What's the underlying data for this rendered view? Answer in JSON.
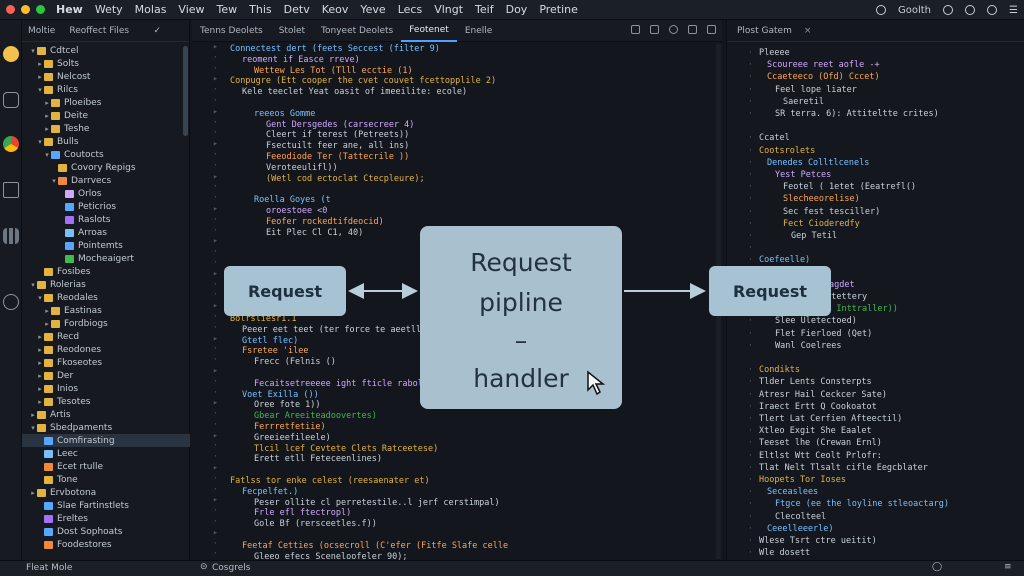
{
  "menubar": {
    "items": [
      "Hew",
      "Wety",
      "Molas",
      "View",
      "Tew",
      "This",
      "Detv",
      "Keov",
      "Yeve",
      "Lecs",
      "Vlngt",
      "Teif",
      "Doy",
      "Pretine"
    ],
    "right_label": "Goolth",
    "traffic_colors": [
      "#ff5f57",
      "#febc2e",
      "#28c840"
    ]
  },
  "sidebar": {
    "tabs": [
      "Moltie",
      "Reoffect Files"
    ],
    "tree": [
      {
        "label": "Cdtcel",
        "indent": 1,
        "color": "#e3b341",
        "twisty": "v"
      },
      {
        "label": "Solts",
        "indent": 2,
        "color": "#e3b341",
        "twisty": ">"
      },
      {
        "label": "Nelcost",
        "indent": 2,
        "color": "#e3b341",
        "twisty": ">"
      },
      {
        "label": "Rilcs",
        "indent": 2,
        "color": "#e3b341",
        "twisty": "v"
      },
      {
        "label": "Ploeibes",
        "indent": 3,
        "color": "#e3b341",
        "twisty": ">"
      },
      {
        "label": "Deite",
        "indent": 3,
        "color": "#e3b341",
        "twisty": ">"
      },
      {
        "label": "Teshe",
        "indent": 3,
        "color": "#e3b341",
        "twisty": ">"
      },
      {
        "label": "Bulls",
        "indent": 2,
        "color": "#e3b341",
        "twisty": "v"
      },
      {
        "label": "Coutocts",
        "indent": 3,
        "color": "#58a6ff",
        "twisty": "v"
      },
      {
        "label": "Covory Repigs",
        "indent": 4,
        "color": "#e3b341",
        "twisty": ""
      },
      {
        "label": "Darrvecs",
        "indent": 4,
        "color": "#f0883e",
        "twisty": "v"
      },
      {
        "label": "Orlos",
        "indent": 5,
        "color": "#d2a8ff",
        "twisty": ""
      },
      {
        "label": "Peticrios",
        "indent": 5,
        "color": "#58a6ff",
        "twisty": ""
      },
      {
        "label": "Raslots",
        "indent": 5,
        "color": "#a371f7",
        "twisty": ""
      },
      {
        "label": "Arroas",
        "indent": 5,
        "color": "#79c0ff",
        "twisty": ""
      },
      {
        "label": "Pointemts",
        "indent": 5,
        "color": "#58a6ff",
        "twisty": ""
      },
      {
        "label": "Mocheaigert",
        "indent": 5,
        "color": "#3fb950",
        "twisty": ""
      },
      {
        "label": "Fosibes",
        "indent": 2,
        "color": "#e3b341",
        "twisty": ""
      },
      {
        "label": "Rolerias",
        "indent": 1,
        "color": "#e3b341",
        "twisty": "v"
      },
      {
        "label": "Reodales",
        "indent": 2,
        "color": "#e3b341",
        "twisty": "v"
      },
      {
        "label": "Eastinas",
        "indent": 3,
        "color": "#e3b341",
        "twisty": ">"
      },
      {
        "label": "Fordbiogs",
        "indent": 3,
        "color": "#e3b341",
        "twisty": ">"
      },
      {
        "label": "Recd",
        "indent": 2,
        "color": "#e3b341",
        "twisty": ">"
      },
      {
        "label": "Reodones",
        "indent": 2,
        "color": "#e3b341",
        "twisty": ">"
      },
      {
        "label": "Fkoseotes",
        "indent": 2,
        "color": "#e3b341",
        "twisty": ">"
      },
      {
        "label": "Der",
        "indent": 2,
        "color": "#e3b341",
        "twisty": ">"
      },
      {
        "label": "Inios",
        "indent": 2,
        "color": "#e3b341",
        "twisty": ">"
      },
      {
        "label": "Tesotes",
        "indent": 2,
        "color": "#e3b341",
        "twisty": ">"
      },
      {
        "label": "Artis",
        "indent": 1,
        "color": "#e3b341",
        "twisty": ">"
      },
      {
        "label": "Sbedpaments",
        "indent": 1,
        "color": "#e3b341",
        "twisty": "v"
      },
      {
        "label": "Comfirasting",
        "indent": 2,
        "color": "#58a6ff",
        "twisty": "",
        "selected": true
      },
      {
        "label": "Leec",
        "indent": 2,
        "color": "#79c0ff",
        "twisty": ""
      },
      {
        "label": "Ecet rtulle",
        "indent": 2,
        "color": "#f0883e",
        "twisty": ""
      },
      {
        "label": "Tone",
        "indent": 2,
        "color": "#e3b341",
        "twisty": ""
      },
      {
        "label": "Ervbotona",
        "indent": 1,
        "color": "#e3b341",
        "twisty": ">"
      },
      {
        "label": "Slae Fartinstlets",
        "indent": 2,
        "color": "#58a6ff",
        "twisty": ""
      },
      {
        "label": "Ereltes",
        "indent": 2,
        "color": "#a371f7",
        "twisty": ""
      },
      {
        "label": "Dost Sophoats",
        "indent": 2,
        "color": "#58a6ff",
        "twisty": ""
      },
      {
        "label": "Foodestores",
        "indent": 2,
        "color": "#f0883e",
        "twisty": ""
      }
    ]
  },
  "statusbar": {
    "left": "Fleat Mole",
    "center": "Cosgrels"
  },
  "editor": {
    "tabs": [
      {
        "label": "Tenns Deolets",
        "active": false
      },
      {
        "label": "Stolet",
        "active": false
      },
      {
        "label": "Tonyeet Deolets",
        "active": false
      },
      {
        "label": "Feotenet",
        "active": true
      },
      {
        "label": "Enelle",
        "active": false
      }
    ],
    "lines": [
      {
        "indent": 0,
        "text": "Connectest dert (feets Seccest (filter 9)",
        "color": "#79c0ff"
      },
      {
        "indent": 1,
        "text": "reoment if Easce rreve)",
        "color": "#d2a8ff"
      },
      {
        "indent": 2,
        "text": "Wettew Les Tot (Tlll ecctie (1)",
        "color": "#ffa657"
      },
      {
        "indent": 0,
        "text": "Conpugre (Ett cooper the cvet couvet fcettopplile 2)",
        "color": "#e3b341"
      },
      {
        "indent": 1,
        "text": "Kele teeclet Yeat oasit of imeeilite: ecole)",
        "color": "#c9d1d9"
      },
      {
        "indent": 0,
        "text": "",
        "color": "#c9d1d9"
      },
      {
        "indent": 2,
        "text": "reeeos Gomme",
        "color": "#79c0ff"
      },
      {
        "indent": 3,
        "text": "Gent Dersgedes (carsecreer 4)",
        "color": "#d2a8ff"
      },
      {
        "indent": 3,
        "text": "Cleert if terest (Petreets))",
        "color": "#c9d1d9"
      },
      {
        "indent": 3,
        "text": "Fsectuilt feer ane, all ins)",
        "color": "#c9d1d9"
      },
      {
        "indent": 3,
        "text": "Feeodiode Ter (Tattecrile ))",
        "color": "#ffa657"
      },
      {
        "indent": 3,
        "text": "Veroteeulifl))",
        "color": "#c9d1d9"
      },
      {
        "indent": 3,
        "text": "(Wetl cod ectoclat Ctecpleure);",
        "color": "#e3b341"
      },
      {
        "indent": 0,
        "text": "",
        "color": "#c9d1d9"
      },
      {
        "indent": 2,
        "text": "Roella Goyes (t",
        "color": "#79c0ff"
      },
      {
        "indent": 3,
        "text": "oroestoee <0",
        "color": "#d2a8ff"
      },
      {
        "indent": 3,
        "text": "Feofer rockedtifdeocid)",
        "color": "#ffa657"
      },
      {
        "indent": 3,
        "text": "Eit Plec Cl C1, 40)",
        "color": "#c9d1d9"
      },
      {
        "indent": 0,
        "text": "",
        "color": "#c9d1d9"
      },
      {
        "indent": 0,
        "text": "",
        "color": "#c9d1d9"
      },
      {
        "indent": 0,
        "text": "",
        "color": "#c9d1d9"
      },
      {
        "indent": 0,
        "text": "",
        "color": "#c9d1d9"
      },
      {
        "indent": 0,
        "text": "",
        "color": "#c9d1d9"
      },
      {
        "indent": 0,
        "text": "",
        "color": "#c9d1d9"
      },
      {
        "indent": 0,
        "text": "",
        "color": "#c9d1d9"
      },
      {
        "indent": 0,
        "text": "Bolrsliesr1.1",
        "color": "#e3b341"
      },
      {
        "indent": 1,
        "text": "Peeer eet teet (ter force te aeetllles",
        "color": "#c9d1d9"
      },
      {
        "indent": 1,
        "text": "Gtetl flec)",
        "color": "#79c0ff"
      },
      {
        "indent": 1,
        "text": "Fsretee 'ilee",
        "color": "#ffa657"
      },
      {
        "indent": 2,
        "text": "Frecc (Felnis ()",
        "color": "#c9d1d9"
      },
      {
        "indent": 0,
        "text": "",
        "color": "#c9d1d9"
      },
      {
        "indent": 2,
        "text": "Fecaitsetreeeee ight fticle rabolec",
        "color": "#d2a8ff"
      },
      {
        "indent": 1,
        "text": "Voet Exilla ())",
        "color": "#79c0ff"
      },
      {
        "indent": 2,
        "text": "Oree fote  1))",
        "color": "#c9d1d9"
      },
      {
        "indent": 2,
        "text": "Gbear Areeiteadoovertes)",
        "color": "#3fb950"
      },
      {
        "indent": 2,
        "text": "Ferrretfetiie)",
        "color": "#ffa657"
      },
      {
        "indent": 2,
        "text": "Greeieefileele)",
        "color": "#c9d1d9"
      },
      {
        "indent": 2,
        "text": "Tlcil lcef Cevtete Clets Ratceetese)",
        "color": "#e3b341"
      },
      {
        "indent": 2,
        "text": "Erett etll Feteceenlines)",
        "color": "#c9d1d9"
      },
      {
        "indent": 0,
        "text": "",
        "color": "#c9d1d9"
      },
      {
        "indent": 0,
        "text": "Fatlss tor enke celest (reesaenater et)",
        "color": "#e3b341"
      },
      {
        "indent": 1,
        "text": "Fecpelfet.)",
        "color": "#79c0ff"
      },
      {
        "indent": 2,
        "text": "Peser ollite cl perretestile..l jerf cerstimpal)",
        "color": "#c9d1d9"
      },
      {
        "indent": 2,
        "text": "Frle efl ftectropl)",
        "color": "#d2a8ff"
      },
      {
        "indent": 2,
        "text": "Gole Bf (rersceetles.f))",
        "color": "#c9d1d9"
      },
      {
        "indent": 0,
        "text": "",
        "color": "#c9d1d9"
      },
      {
        "indent": 1,
        "text": "Feetaf Cetties (ocsecroll (C'efer (Fitfe Slafe celle",
        "color": "#ffa657"
      },
      {
        "indent": 2,
        "text": "Gleeo efecs Sceneloofeler 90);",
        "color": "#c9d1d9"
      }
    ]
  },
  "rightpanel": {
    "tab": "Plost Gatem",
    "blocks": [
      {
        "start": 1,
        "lines": [
          {
            "indent": 0,
            "text": "Pleeee",
            "color": "#c9d1d9"
          },
          {
            "indent": 1,
            "text": "Scoureee reet aofle -+",
            "color": "#d2a8ff"
          },
          {
            "indent": 1,
            "text": "Ccaeteeco (Ofd) Cccet)",
            "color": "#ffa657"
          },
          {
            "indent": 2,
            "text": "Feel lope liater",
            "color": "#c9d1d9"
          },
          {
            "indent": 3,
            "text": "Saeretil",
            "color": "#c9d1d9"
          },
          {
            "indent": 2,
            "text": "SR terra.  6): Attiteltte crites)",
            "color": "#c9d1d9"
          }
        ]
      },
      {
        "start": 5,
        "lines": [
          {
            "indent": 0,
            "text": "Ccatel",
            "color": "#c9d1d9"
          },
          {
            "indent": 0,
            "text": "Cootsrolets",
            "color": "#e3b341"
          },
          {
            "indent": 1,
            "text": "Denedes Colltlcenels",
            "color": "#79c0ff"
          },
          {
            "indent": 2,
            "text": "Yest Petces",
            "color": "#d2a8ff"
          },
          {
            "indent": 3,
            "text": "Feotel ( 1etet (Eeatrefl()",
            "color": "#c9d1d9"
          },
          {
            "indent": 3,
            "text": "Slecheeorelise)",
            "color": "#ffa657"
          },
          {
            "indent": 3,
            "text": "Sec fest tesciller)",
            "color": "#c9d1d9"
          },
          {
            "indent": 3,
            "text": "Fect Cioderedfy",
            "color": "#e3b341"
          },
          {
            "indent": 4,
            "text": "Gep Tetil",
            "color": "#c9d1d9"
          },
          {
            "indent": 0,
            "text": "",
            "color": "#c9d1d9"
          },
          {
            "indent": 0,
            "text": "Coefeelle)",
            "color": "#79c0ff"
          },
          {
            "indent": 2,
            "text": "Flerees",
            "color": "#c9d1d9"
          },
          {
            "indent": 3,
            "text": "Eistlk Plagdet",
            "color": "#d2a8ff"
          },
          {
            "indent": 2,
            "text": "Sertatle Eltettery",
            "color": "#c9d1d9"
          },
          {
            "indent": 2,
            "text": "Ecl sutplie Inttraller))",
            "color": "#3fb950"
          },
          {
            "indent": 2,
            "text": "Slee Uletectoed)",
            "color": "#c9d1d9"
          },
          {
            "indent": 2,
            "text": "Flet Fierloed (Qet)",
            "color": "#c9d1d9"
          },
          {
            "indent": 2,
            "text": "Wanl Coelrees",
            "color": "#c9d1d9"
          }
        ]
      },
      {
        "start": 11,
        "lines": [
          {
            "indent": 0,
            "text": "Condikts",
            "color": "#e3b341"
          },
          {
            "indent": 0,
            "text": "Tlder Lents Consterpts",
            "color": "#c9d1d9"
          },
          {
            "indent": 0,
            "text": "Atresr Hail Ceckcer Sate)",
            "color": "#c9d1d9"
          },
          {
            "indent": 0,
            "text": "Iraect Ertt  Q  Cookoatot",
            "color": "#c9d1d9"
          },
          {
            "indent": 0,
            "text": "Tlert Lat Cerfien Afteectil)",
            "color": "#c9d1d9"
          },
          {
            "indent": 0,
            "text": "Xtleo Exgit She Eaalet",
            "color": "#c9d1d9"
          },
          {
            "indent": 0,
            "text": "Teeset lhe (Crewan Ernl)",
            "color": "#c9d1d9"
          },
          {
            "indent": 0,
            "text": "Eltlst Wtt Ceolt Prlofr:",
            "color": "#c9d1d9"
          },
          {
            "indent": 0,
            "text": "Tlat Nelt Tlsalt cifle Eegcblater",
            "color": "#c9d1d9"
          },
          {
            "indent": 0,
            "text": "Hoopets Tor Ioses",
            "color": "#e3b341"
          },
          {
            "indent": 1,
            "text": "Seceaslees",
            "color": "#79c0ff"
          },
          {
            "indent": 2,
            "text": "Ftgce (ee the loyline stleoactarg)",
            "color": "#79c0ff"
          },
          {
            "indent": 2,
            "text": "Clecolteel",
            "color": "#c9d1d9"
          },
          {
            "indent": 1,
            "text": "Ceeelleeerle)",
            "color": "#79c0ff"
          },
          {
            "indent": 0,
            "text": "Wlese Tsrt ctre ueitit)",
            "color": "#c9d1d9"
          },
          {
            "indent": 0,
            "text": "Wle dosett",
            "color": "#c9d1d9"
          },
          {
            "indent": 0,
            "text": "Treay Blla Gtseble",
            "color": "#c9d1d9"
          }
        ]
      }
    ]
  },
  "diagram": {
    "left_box": "Request",
    "right_box": "Request",
    "center_lines": [
      "Request",
      "pipline",
      "–",
      "handler"
    ],
    "box_color": "#a9c0cf",
    "arrow_color": "#b8cedb"
  }
}
